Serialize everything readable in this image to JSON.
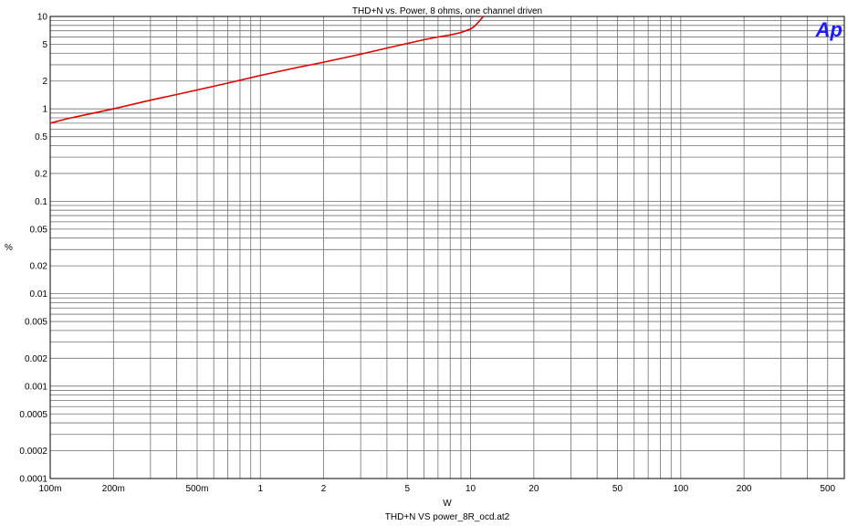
{
  "chart_data": {
    "type": "line",
    "title": "THD+N vs. Power, 8 ohms, one channel driven",
    "xlabel": "W",
    "ylabel": "%",
    "footer": "THD+N VS power_8R_ocd.at2",
    "logo": "Ap",
    "x_scale": "log",
    "y_scale": "log",
    "xlim": [
      0.1,
      600
    ],
    "ylim": [
      0.0001,
      10
    ],
    "grid": true,
    "x_tick_labels": [
      {
        "v": 0.1,
        "t": "100m"
      },
      {
        "v": 0.2,
        "t": "200m"
      },
      {
        "v": 0.5,
        "t": "500m"
      },
      {
        "v": 1,
        "t": "1"
      },
      {
        "v": 2,
        "t": "2"
      },
      {
        "v": 5,
        "t": "5"
      },
      {
        "v": 10,
        "t": "10"
      },
      {
        "v": 20,
        "t": "20"
      },
      {
        "v": 50,
        "t": "50"
      },
      {
        "v": 100,
        "t": "100"
      },
      {
        "v": 200,
        "t": "200"
      },
      {
        "v": 500,
        "t": "500"
      }
    ],
    "y_tick_labels": [
      {
        "v": 10,
        "t": "10"
      },
      {
        "v": 5,
        "t": "5"
      },
      {
        "v": 2,
        "t": "2"
      },
      {
        "v": 1,
        "t": "1"
      },
      {
        "v": 0.5,
        "t": "0.5"
      },
      {
        "v": 0.2,
        "t": "0.2"
      },
      {
        "v": 0.1,
        "t": "0.1"
      },
      {
        "v": 0.05,
        "t": "0.05"
      },
      {
        "v": 0.02,
        "t": "0.02"
      },
      {
        "v": 0.01,
        "t": "0.01"
      },
      {
        "v": 0.005,
        "t": "0.005"
      },
      {
        "v": 0.002,
        "t": "0.002"
      },
      {
        "v": 0.001,
        "t": "0.001"
      },
      {
        "v": 0.0005,
        "t": "0.0005"
      },
      {
        "v": 0.0002,
        "t": "0.0002"
      },
      {
        "v": 0.0001,
        "t": "0.0001"
      }
    ],
    "series": [
      {
        "color": "#e00000",
        "x": [
          0.1,
          0.12,
          0.15,
          0.2,
          0.3,
          0.4,
          0.5,
          0.7,
          1,
          1.5,
          2,
          3,
          4,
          5,
          6,
          7,
          8,
          9,
          10,
          10.5,
          11,
          11.5
        ],
        "y": [
          0.7,
          0.78,
          0.87,
          1.0,
          1.24,
          1.43,
          1.6,
          1.9,
          2.3,
          2.8,
          3.2,
          3.9,
          4.55,
          5.1,
          5.6,
          6.0,
          6.3,
          6.7,
          7.3,
          7.9,
          8.9,
          10.0
        ]
      }
    ]
  }
}
